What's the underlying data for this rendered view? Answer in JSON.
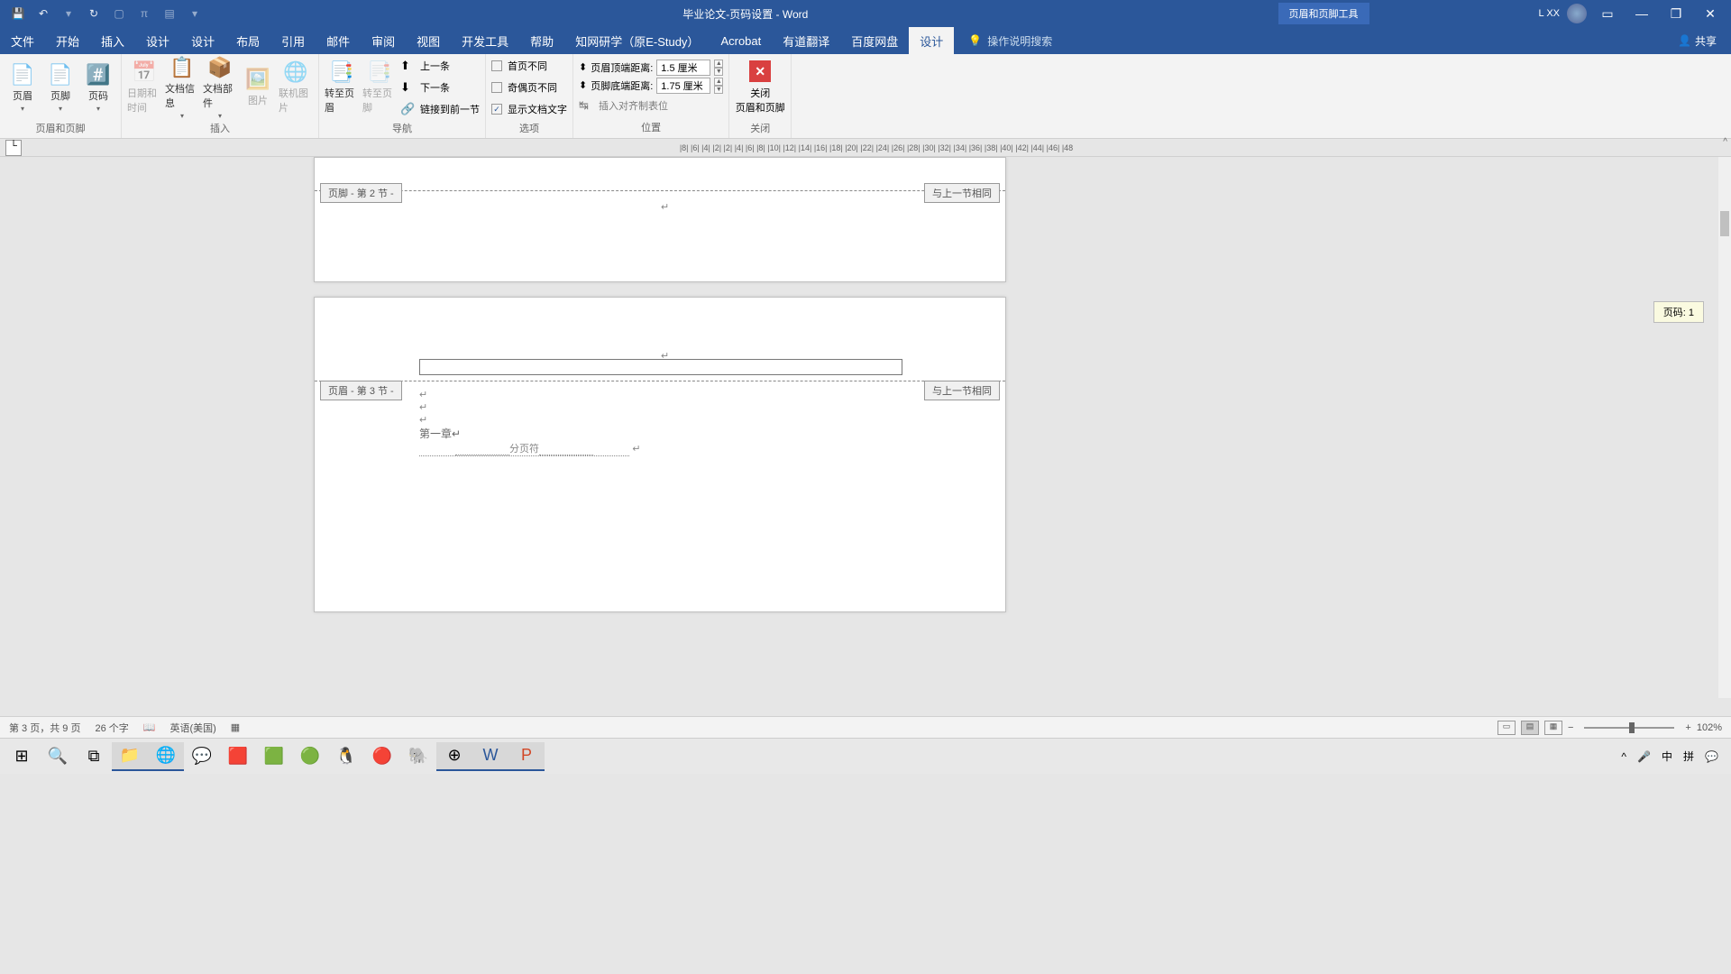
{
  "title": "毕业论文-页码设置 - Word",
  "contextual_tab": "页眉和页脚工具",
  "user": "L XX",
  "menu": [
    "文件",
    "开始",
    "插入",
    "设计",
    "设计",
    "布局",
    "引用",
    "邮件",
    "审阅",
    "视图",
    "开发工具",
    "帮助",
    "知网研学（原E-Study）",
    "Acrobat",
    "有道翻译",
    "百度网盘",
    "设计"
  ],
  "active_menu_index": 16,
  "tell_me": "操作说明搜索",
  "share": "共享",
  "groups": {
    "hf": {
      "label": "页眉和页脚",
      "items": [
        "页眉",
        "页脚",
        "页码"
      ]
    },
    "insert": {
      "label": "插入",
      "items": [
        "日期和时间",
        "文档信息",
        "文档部件",
        "图片",
        "联机图片"
      ]
    },
    "nav": {
      "label": "导航",
      "goto_header": "转至页眉",
      "goto_footer": "转至页脚",
      "prev": "上一条",
      "next": "下一条",
      "link": "链接到前一节"
    },
    "options": {
      "label": "选项",
      "diff_first": "首页不同",
      "diff_odd_even": "奇偶页不同",
      "show_text": "显示文档文字"
    },
    "position": {
      "label": "位置",
      "header_label": "页眉顶端距离:",
      "header_val": "1.5 厘米",
      "footer_label": "页脚底端距离:",
      "footer_val": "1.75 厘米",
      "insert_align": "插入对齐制表位"
    },
    "close": {
      "label": "关闭",
      "close_hf": "关闭",
      "close_hf2": "页眉和页脚"
    }
  },
  "ruler_ticks": "|8|  |6|  |4|  |2|        |2|  |4|  |6|  |8|  |10|  |12|  |14|  |16|  |18|  |20|  |22|  |24|  |26|  |28|  |30|  |32|  |34|  |36|  |38|  |40|  |42|  |44|  |46|  |48",
  "doc": {
    "footer_tag": "页脚 - 第 2 节 -",
    "same_as_prev": "与上一节相同",
    "header_tag": "页眉 - 第 3 节 -",
    "chapter": "第一章↵",
    "page_break": "分页符"
  },
  "page_tooltip": "页码: 1",
  "status": {
    "page": "第 3 页，共 9 页",
    "words": "26 个字",
    "lang": "英语(美国)",
    "zoom": "102%"
  },
  "tray": {
    "ime": "中",
    "kbd": "拼"
  }
}
